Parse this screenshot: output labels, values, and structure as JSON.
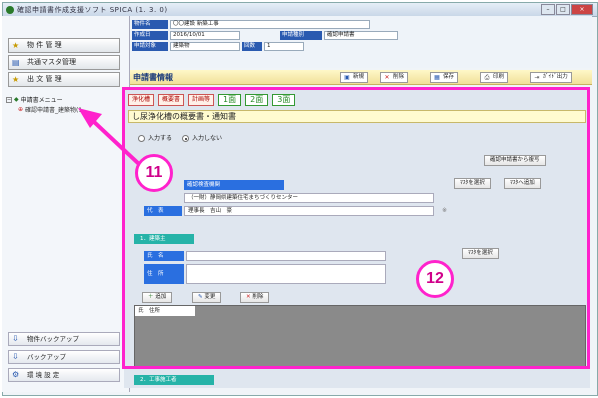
{
  "window": {
    "title": "確認申請書作成支援ソフト SPICA (1. 3. 0)",
    "controls": [
      "–",
      "□",
      "×"
    ]
  },
  "sidebar": {
    "top_buttons": [
      {
        "label": "物 件 管 理",
        "icon": "star-icon"
      },
      {
        "label": "共通マスタ管理",
        "icon": "database-icon"
      },
      {
        "label": "出 文 管 理",
        "icon": "star-icon"
      }
    ],
    "tree": {
      "root_label": "申請書メニュー",
      "child_label": "確認申請書_建築物(1"
    },
    "bottom_buttons": [
      {
        "label": "物件バックアップ",
        "icon": "backup-icon"
      },
      {
        "label": "バックアップ",
        "icon": "backup-icon"
      },
      {
        "label": "環 境 設 定",
        "icon": "settings-icon"
      }
    ]
  },
  "header": {
    "property_name_label": "物件名",
    "property_name_value": "〇〇建設 新築工事",
    "created_label": "作成日",
    "created_value": "2016/10/01",
    "app_type_label": "申請種別",
    "app_type_value": "確認申請書",
    "app_target_label": "申請対象",
    "app_target_value": "建築物",
    "count_label": "回数",
    "count_value": "1"
  },
  "ribbon": {
    "title": "申請書情報",
    "buttons": [
      {
        "label": "新規",
        "icon": "new-icon"
      },
      {
        "label": "削除",
        "icon": "delete-icon"
      },
      {
        "label": "保存",
        "icon": "save-icon"
      },
      {
        "label": "印刷",
        "icon": "print-icon"
      },
      {
        "label": "ｶﾞｲﾄﾞ出力",
        "icon": "export-icon"
      }
    ]
  },
  "main": {
    "tabs": [
      "浄化槽",
      "概要書",
      "計画等"
    ],
    "page_tabs": [
      "1面",
      "2面",
      "3面"
    ],
    "form_title": "し尿浄化槽の概要書・通知書",
    "radio": {
      "option1": "入力する",
      "option2": "入力しない"
    },
    "copy_button": "確認申請書から複写",
    "fields": {
      "office_label": "確認検査機関",
      "office_value": "（一財）静岡県建築住宅まちづくりセンター",
      "rep_label": "代　表",
      "rep_value": "理事長　吉山　豪"
    },
    "select_buttons": [
      "ﾏｽﾀを選択",
      "ﾏｽﾀへ追加"
    ],
    "section1": "1．建築主",
    "owner_name_label": "氏　名",
    "owner_addr_label": "住　所",
    "owner_select": "ﾏｽﾀを選択",
    "row_buttons": [
      "追加",
      "変更",
      "削除"
    ],
    "table_header": "氏　住所",
    "section2": "2．工事施工者",
    "asterisk": "※"
  },
  "annotations": {
    "arrow_label": "11",
    "frame_label": "12"
  },
  "colors": {
    "accent_blue": "#2a5ab0",
    "highlight": "#ff22cc",
    "teal": "#26b3a8"
  }
}
